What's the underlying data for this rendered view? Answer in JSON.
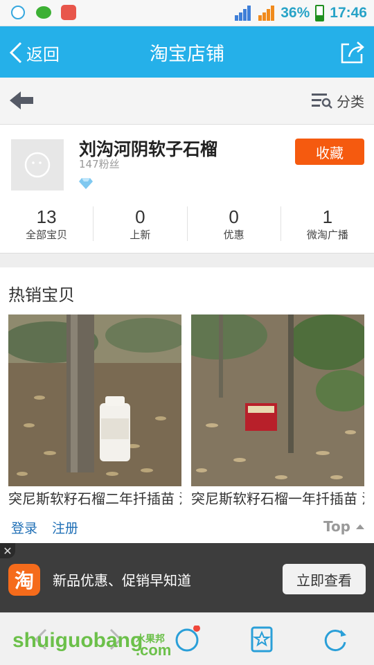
{
  "status_bar": {
    "battery_percent": "36%",
    "time": "17:46",
    "network": "E"
  },
  "header": {
    "back_label": "返回",
    "title": "淘宝店铺"
  },
  "subbar": {
    "category_label": "分类"
  },
  "shop": {
    "name": "刘沟河阴软子石榴",
    "fans": "147粉丝",
    "favorite_label": "收藏",
    "stats": [
      {
        "value": "13",
        "label": "全部宝贝"
      },
      {
        "value": "0",
        "label": "上新"
      },
      {
        "value": "0",
        "label": "优惠"
      },
      {
        "value": "1",
        "label": "微淘广播"
      }
    ]
  },
  "hot": {
    "title": "热销宝贝",
    "items": [
      {
        "title": "突尼斯软籽石榴二年扦插苗 河阴软籽石榴"
      },
      {
        "title": "突尼斯软籽石榴一年扦插苗 河阴软籽石榴"
      }
    ]
  },
  "login_bar": {
    "login": "登录",
    "register": "注册",
    "top": "Top"
  },
  "ad": {
    "logo": "淘",
    "text": "新品优惠、促销早知道",
    "button": "立即查看"
  },
  "watermark": {
    "text": "shuiguobang",
    "cn": "水果邦",
    "com": ".com"
  },
  "colors": {
    "accent": "#25b0e9",
    "favorite": "#f55a0f",
    "ad_background": "#3d3d3d"
  }
}
